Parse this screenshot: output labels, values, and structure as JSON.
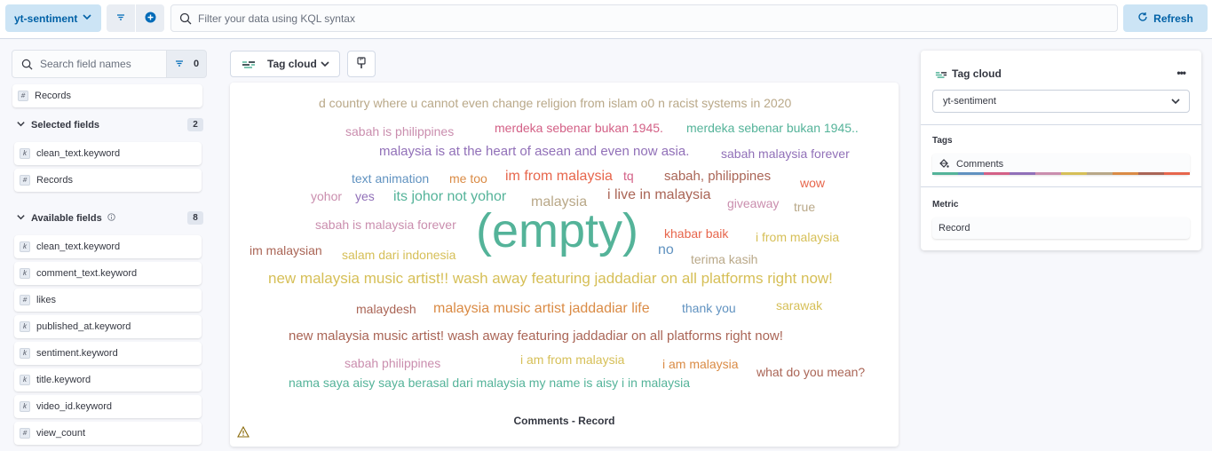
{
  "header": {
    "dataview_label": "yt-sentiment",
    "kql_placeholder": "Filter your data using KQL syntax",
    "refresh_label": "Refresh"
  },
  "sidebar": {
    "search_placeholder": "Search field names",
    "filter_count": "0",
    "records_label": "Records",
    "selected_section": {
      "label": "Selected fields",
      "count": "2"
    },
    "selected_fields": [
      {
        "type": "k",
        "name": "clean_text.keyword"
      },
      {
        "type": "#",
        "name": "Records"
      }
    ],
    "available_section": {
      "label": "Available fields",
      "count": "8"
    },
    "available_fields": [
      {
        "type": "k",
        "name": "clean_text.keyword"
      },
      {
        "type": "k",
        "name": "comment_text.keyword"
      },
      {
        "type": "#",
        "name": "likes"
      },
      {
        "type": "k",
        "name": "published_at.keyword"
      },
      {
        "type": "k",
        "name": "sentiment.keyword"
      },
      {
        "type": "k",
        "name": "title.keyword"
      },
      {
        "type": "k",
        "name": "video_id.keyword"
      },
      {
        "type": "#",
        "name": "view_count"
      }
    ]
  },
  "toolbar": {
    "vis_type_label": "Tag cloud"
  },
  "cloud": {
    "caption": "Comments - Record",
    "words": [
      "d country where u cannot even change religion from islam o0 n racist systems in 2020",
      "sabah is philippines",
      "merdeka sebenar bukan 1945.",
      "merdeka sebenar bukan 1945..",
      "malaysia is at the heart of asean and even now asia.",
      "sabah malaysia forever",
      "text animation",
      "me too",
      "im from malaysia",
      "tq",
      "sabah, philippines",
      "wow",
      "yohor",
      "yes",
      "its johor not yohor",
      "malaysia",
      "i live in malaysia",
      "giveaway",
      "true",
      "sabah is malaysia forever",
      "(empty)",
      "khabar baik",
      "i from malaysia",
      "im malaysian",
      "salam dari indonesia",
      "no",
      "terima kasih",
      "new malaysia music artist!! wash away featuring jaddadiar on all platforms right now!",
      "malaydesh",
      "malaysia music artist jaddadiar life",
      "thank you",
      "sarawak",
      "new malaysia music artist! wash away featuring jaddadiar on all platforms right now!",
      "sabah philippines",
      "i am from malaysia",
      "i am malaysia",
      "what do you mean?",
      "nama saya aisy saya berasal dari malaysia my name is aisy i in malaysia"
    ]
  },
  "config_panel": {
    "title": "Tag cloud",
    "dataview": "yt-sentiment",
    "tags_label": "Tags",
    "tags_value": "Comments",
    "metric_label": "Metric",
    "metric_value": "Record",
    "palette": [
      "#54b399",
      "#6092c0",
      "#d36086",
      "#9170b8",
      "#ca8eae",
      "#d6bf57",
      "#b9a888",
      "#da8b45",
      "#aa6556",
      "#e7664c"
    ]
  }
}
